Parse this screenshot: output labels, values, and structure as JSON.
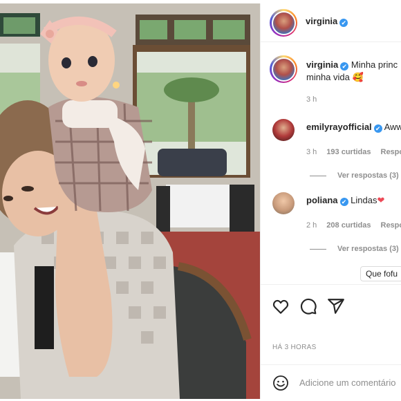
{
  "post": {
    "author": "virginia",
    "caption_line1": "Minha princ",
    "caption_line2": "minha vida 🥰",
    "caption_time": "3 h",
    "posted_ago": "HÁ 3 HORAS"
  },
  "comments": [
    {
      "username": "emilyrayofficial",
      "text": "Aww",
      "time": "3 h",
      "likes": "193 curtidas",
      "reply": "Respo",
      "view_replies": "Ver respostas (3)"
    },
    {
      "username": "poliana",
      "text": "Lindas",
      "heart": "❤",
      "time": "2 h",
      "likes": "208 curtidas",
      "reply": "Respo",
      "view_replies": "Ver respostas (3)"
    }
  ],
  "tooltip": "Que fofu",
  "verified_glyph": "✔",
  "add_comment": {
    "placeholder": "Adicione um comentário"
  },
  "icons": [
    "heart-icon",
    "comment-icon",
    "share-icon",
    "emoji-icon"
  ],
  "colors": {
    "verified": "#3897f0",
    "muted": "#8e8e8e",
    "heart_red": "#ed4956"
  }
}
